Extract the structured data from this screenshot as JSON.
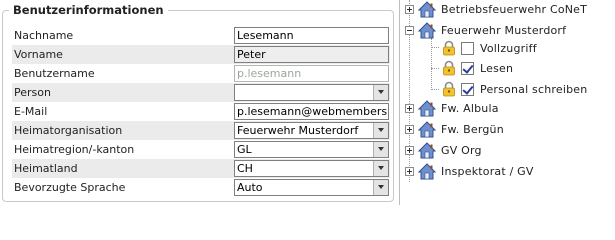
{
  "form": {
    "legend": "Benutzerinformationen",
    "rows": [
      {
        "label": "Nachname",
        "value": "Lesemann",
        "kind": "text"
      },
      {
        "label": "Vorname",
        "value": "Peter",
        "kind": "text"
      },
      {
        "label": "Benutzername",
        "value": "p.lesemann",
        "kind": "disabled"
      },
      {
        "label": "Person",
        "value": "",
        "kind": "select"
      },
      {
        "label": "E-Mail",
        "value": "p.lesemann@webmembers",
        "kind": "text"
      },
      {
        "label": "Heimatorganisation",
        "value": "Feuerwehr Musterdorf",
        "kind": "select"
      },
      {
        "label": "Heimatregion/-kanton",
        "value": "GL",
        "kind": "select"
      },
      {
        "label": "Heimatland",
        "value": "CH",
        "kind": "select"
      },
      {
        "label": "Bevorzugte Sprache",
        "value": "Auto",
        "kind": "select"
      }
    ]
  },
  "tree": {
    "nodes": [
      {
        "label": "Betriebsfeuerwehr CoNeT",
        "expander": "plus",
        "icon": "house-icon"
      },
      {
        "label": "Feuerwehr Musterdorf",
        "expander": "minus",
        "icon": "house-icon"
      },
      {
        "label": "Vollzugriff",
        "icon": "lock-icon",
        "checked": false
      },
      {
        "label": "Lesen",
        "icon": "lock-icon",
        "checked": true
      },
      {
        "label": "Personal schreiben",
        "icon": "lock-icon",
        "checked": true
      },
      {
        "label": "Fw. Albula",
        "expander": "plus",
        "icon": "house-icon"
      },
      {
        "label": "Fw. Bergün",
        "expander": "plus",
        "icon": "house-icon"
      },
      {
        "label": "GV Org",
        "expander": "plus",
        "icon": "house-icon"
      },
      {
        "label": "Inspektorat / GV",
        "expander": "plus",
        "icon": "house-icon"
      }
    ]
  }
}
